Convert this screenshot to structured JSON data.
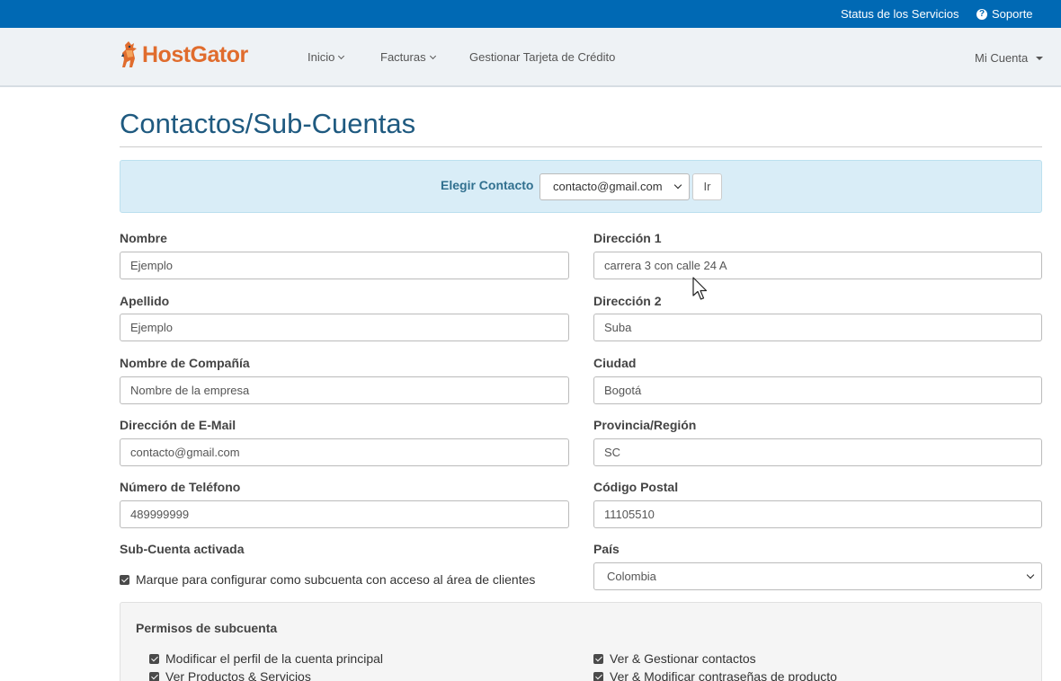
{
  "topbar": {
    "status_label": "Status de los Servicios",
    "support_label": "Soporte"
  },
  "nav": {
    "brand": "HostGator",
    "items": [
      {
        "label": "Inicio"
      },
      {
        "label": "Facturas"
      },
      {
        "label": "Gestionar Tarjeta de Crédito"
      }
    ],
    "account_label": "Mi Cuenta"
  },
  "page": {
    "title": "Contactos/Sub-Cuentas"
  },
  "chooser": {
    "label": "Elegir Contacto",
    "selected": "contacto@gmail.com",
    "go_label": "Ir"
  },
  "form": {
    "nombre": {
      "label": "Nombre",
      "value": "Ejemplo"
    },
    "apellido": {
      "label": "Apellido",
      "value": "Ejemplo"
    },
    "compania": {
      "label": "Nombre de Compañía",
      "value": "Nombre de la empresa"
    },
    "email": {
      "label": "Dirección de E-Mail",
      "value": "contacto@gmail.com"
    },
    "telefono": {
      "label": "Número de Teléfono",
      "value": "489999999"
    },
    "direccion1": {
      "label": "Dirección 1",
      "value": "carrera 3 con calle 24 A"
    },
    "direccion2": {
      "label": "Dirección 2",
      "value": "Suba"
    },
    "ciudad": {
      "label": "Ciudad",
      "value": "Bogotá"
    },
    "provincia": {
      "label": "Provincia/Región",
      "value": "SC"
    },
    "postal": {
      "label": "Código Postal",
      "value": "11105510"
    },
    "pais": {
      "label": "País",
      "value": "Colombia"
    },
    "subcuenta": {
      "label": "Sub-Cuenta activada",
      "checkbox_label": "Marque para configurar como subcuenta con acceso al área de clientes",
      "checked": true
    }
  },
  "permissions": {
    "title": "Permisos de subcuenta",
    "items": [
      {
        "label": "Modificar el perfil de la cuenta principal",
        "checked": true
      },
      {
        "label": "Ver & Gestionar contactos",
        "checked": true
      },
      {
        "label": "Ver Productos & Servicios",
        "checked": true
      },
      {
        "label": "Ver & Modificar contraseñas de producto",
        "checked": true
      }
    ]
  },
  "colors": {
    "topbar": "#0069b4",
    "brand_orange": "#e06c2d",
    "title_blue": "#1f5a80",
    "info_bg": "#d9edf7",
    "info_text": "#31708f"
  }
}
